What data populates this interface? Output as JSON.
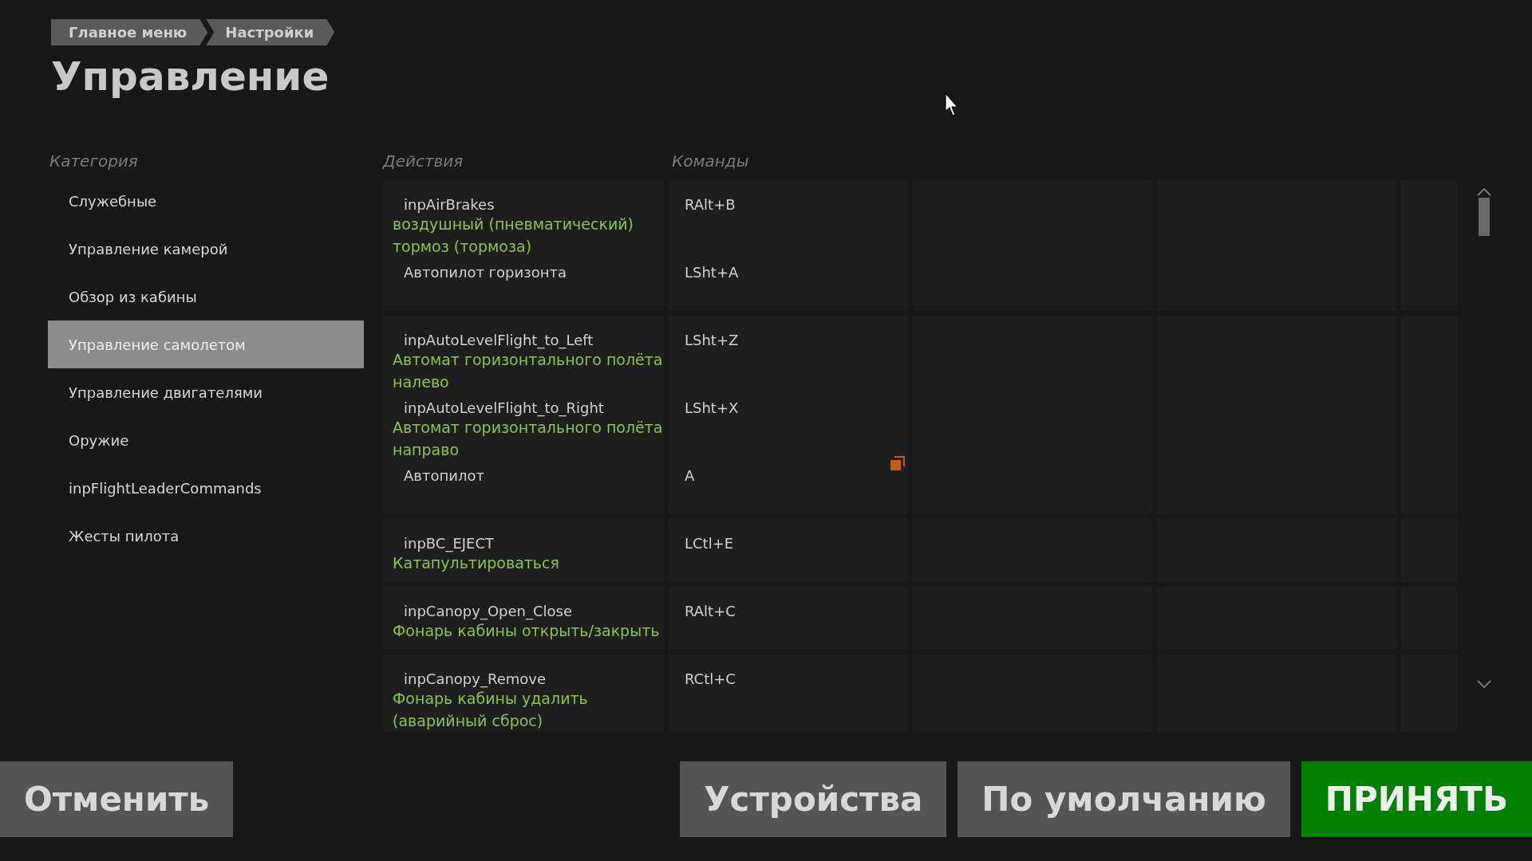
{
  "breadcrumb": [
    {
      "label": "Главное меню"
    },
    {
      "label": "Настройки"
    }
  ],
  "title": "Управление",
  "sidebar": {
    "header": "Категория",
    "items": [
      {
        "label": "Служебные",
        "selected": false
      },
      {
        "label": "Управление камерой",
        "selected": false
      },
      {
        "label": "Обзор из кабины",
        "selected": false
      },
      {
        "label": "Управление самолетом",
        "selected": true
      },
      {
        "label": "Управление двигателями",
        "selected": false
      },
      {
        "label": "Оружие",
        "selected": false
      },
      {
        "label": "inpFlightLeaderCommands",
        "selected": false
      },
      {
        "label": "Жесты пилота",
        "selected": false
      }
    ]
  },
  "table": {
    "columns": [
      "Действия",
      "Команды"
    ],
    "rows": [
      {
        "action": "inpAirBrakes",
        "description": "воздушный (пневматический) тормоз (тормоза)",
        "command": "RAlt+B"
      },
      {
        "action": "Автопилот горизонта",
        "command": "LSht+A"
      },
      {
        "action": "inpAutoLevelFlight_to_Left",
        "description": "Автомат горизонтального полёта налево",
        "command": "LSht+Z"
      },
      {
        "action": "inpAutoLevelFlight_to_Right",
        "description": "Автомат горизонтального полёта направо",
        "command": "LSht+X"
      },
      {
        "action": "Автопилот",
        "command": "A"
      },
      {
        "action": "inpBC_EJECT",
        "description": "Катапультироваться",
        "command": "LCtl+E"
      },
      {
        "action": "inpCanopy_Open_Close",
        "description": "Фонарь кабины открыть/закрыть",
        "command": "RAlt+C"
      },
      {
        "action": "inpCanopy_Remove",
        "description": "Фонарь кабины удалить (аварийный сброс)",
        "command": "RCtl+C"
      }
    ]
  },
  "buttons": [
    {
      "label": "Отменить",
      "kind": "plain"
    },
    {
      "label": "Устройства",
      "kind": "plain"
    },
    {
      "label": "По умолчанию",
      "kind": "plain"
    },
    {
      "label": "ПРИНЯТЬ",
      "kind": "primary"
    }
  ]
}
